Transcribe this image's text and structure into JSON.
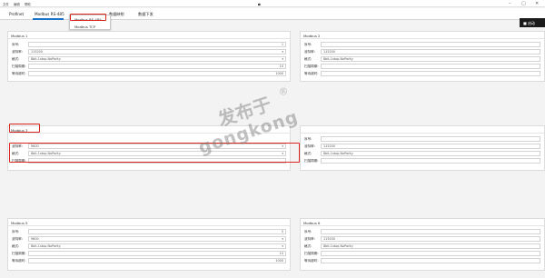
{
  "menu": {
    "items": [
      "文件",
      "编辑",
      "帮助"
    ]
  },
  "toolbar": {
    "run_label": "启动"
  },
  "tabs": [
    "Profinet",
    "Modbus RS-485",
    "数据映射",
    "数据下发"
  ],
  "dropdown": {
    "options": [
      "Modbus RS-485",
      "Modbus TCP"
    ]
  },
  "labels": {
    "seq": "序号:",
    "baud": "波特率:",
    "format": "格式:",
    "scan_period": "扫描周期:",
    "timeout": "等待超时:"
  },
  "panels": [
    {
      "title": "Modbus 1",
      "seq": "1",
      "baud": "115200",
      "format": "8bit-1stop-NoParity",
      "scan_period": "10",
      "timeout": "1000"
    },
    {
      "title": "Modbus 2",
      "seq": "",
      "baud": "115200",
      "format": "8bit-1stop-NoParity",
      "scan_period": "",
      "timeout": ""
    },
    {
      "title": "Modbus 3",
      "seq": "",
      "baud": "9600",
      "format": "8bit-1stop-NoParity",
      "scan_period": "",
      "timeout": ""
    },
    {
      "title": "",
      "seq": "",
      "baud": "115200",
      "format": "8bit-1stop-NoParity",
      "scan_period": "",
      "timeout": ""
    },
    {
      "title": "Modbus 5",
      "seq": "5",
      "baud": "9600",
      "format": "8bit-1stop-NoParity",
      "scan_period": "10",
      "timeout": "1000"
    },
    {
      "title": "Modbus 6",
      "seq": "",
      "baud": "115200",
      "format": "8bit-1stop-NoParity",
      "scan_period": "",
      "timeout": ""
    }
  ],
  "watermark": {
    "cn": "发布于",
    "en": "gongkong",
    "reg": "®"
  }
}
